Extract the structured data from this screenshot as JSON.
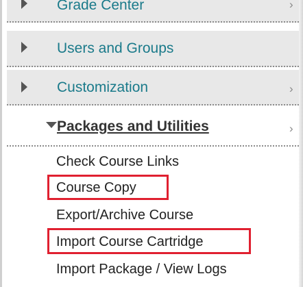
{
  "menu": {
    "items": [
      {
        "label": "Grade Center",
        "expanded": false,
        "has_chevron": true
      },
      {
        "label": "Users and Groups",
        "expanded": false,
        "has_chevron": false
      },
      {
        "label": "Customization",
        "expanded": false,
        "has_chevron": true
      },
      {
        "label": "Packages and Utilities",
        "expanded": true,
        "has_chevron": true
      }
    ],
    "chevron_glyph": "›"
  },
  "submenu": {
    "items": [
      {
        "label": "Check Course Links",
        "highlighted": false
      },
      {
        "label": "Course Copy",
        "highlighted": true
      },
      {
        "label": "Export/Archive Course",
        "highlighted": false
      },
      {
        "label": "Import Course Cartridge",
        "highlighted": true
      },
      {
        "label": "Import Package / View Logs",
        "highlighted": false
      }
    ]
  },
  "colors": {
    "link": "#1a7a8a",
    "highlight_box": "#e02030",
    "row_background": "#e8e8e8"
  },
  "icons": {
    "collapsed": "triangle-right-icon",
    "expanded": "triangle-down-icon",
    "chevron": "chevron-right-icon"
  }
}
